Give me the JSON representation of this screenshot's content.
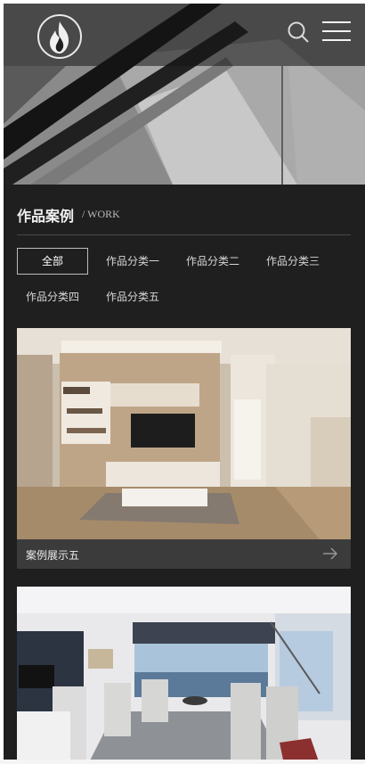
{
  "header": {
    "logo_icon": "flame-icon",
    "search_icon": "search-icon",
    "menu_icon": "hamburger-menu-icon"
  },
  "section": {
    "title": "作品案例",
    "subtitle": "/ WORK"
  },
  "tabs": [
    {
      "label": "全部",
      "active": true
    },
    {
      "label": "作品分类一",
      "active": false
    },
    {
      "label": "作品分类二",
      "active": false
    },
    {
      "label": "作品分类三",
      "active": false
    },
    {
      "label": "作品分类四",
      "active": false
    },
    {
      "label": "作品分类五",
      "active": false
    }
  ],
  "cards": [
    {
      "caption": "案例展示五",
      "image": "living-room-photo",
      "arrow_icon": "arrow-right-icon"
    },
    {
      "caption": "",
      "image": "dining-room-photo"
    }
  ],
  "colors": {
    "page_bg": "#1f1f1f",
    "caption_bg": "#3b3b3b",
    "text": "#f1f1f1"
  }
}
